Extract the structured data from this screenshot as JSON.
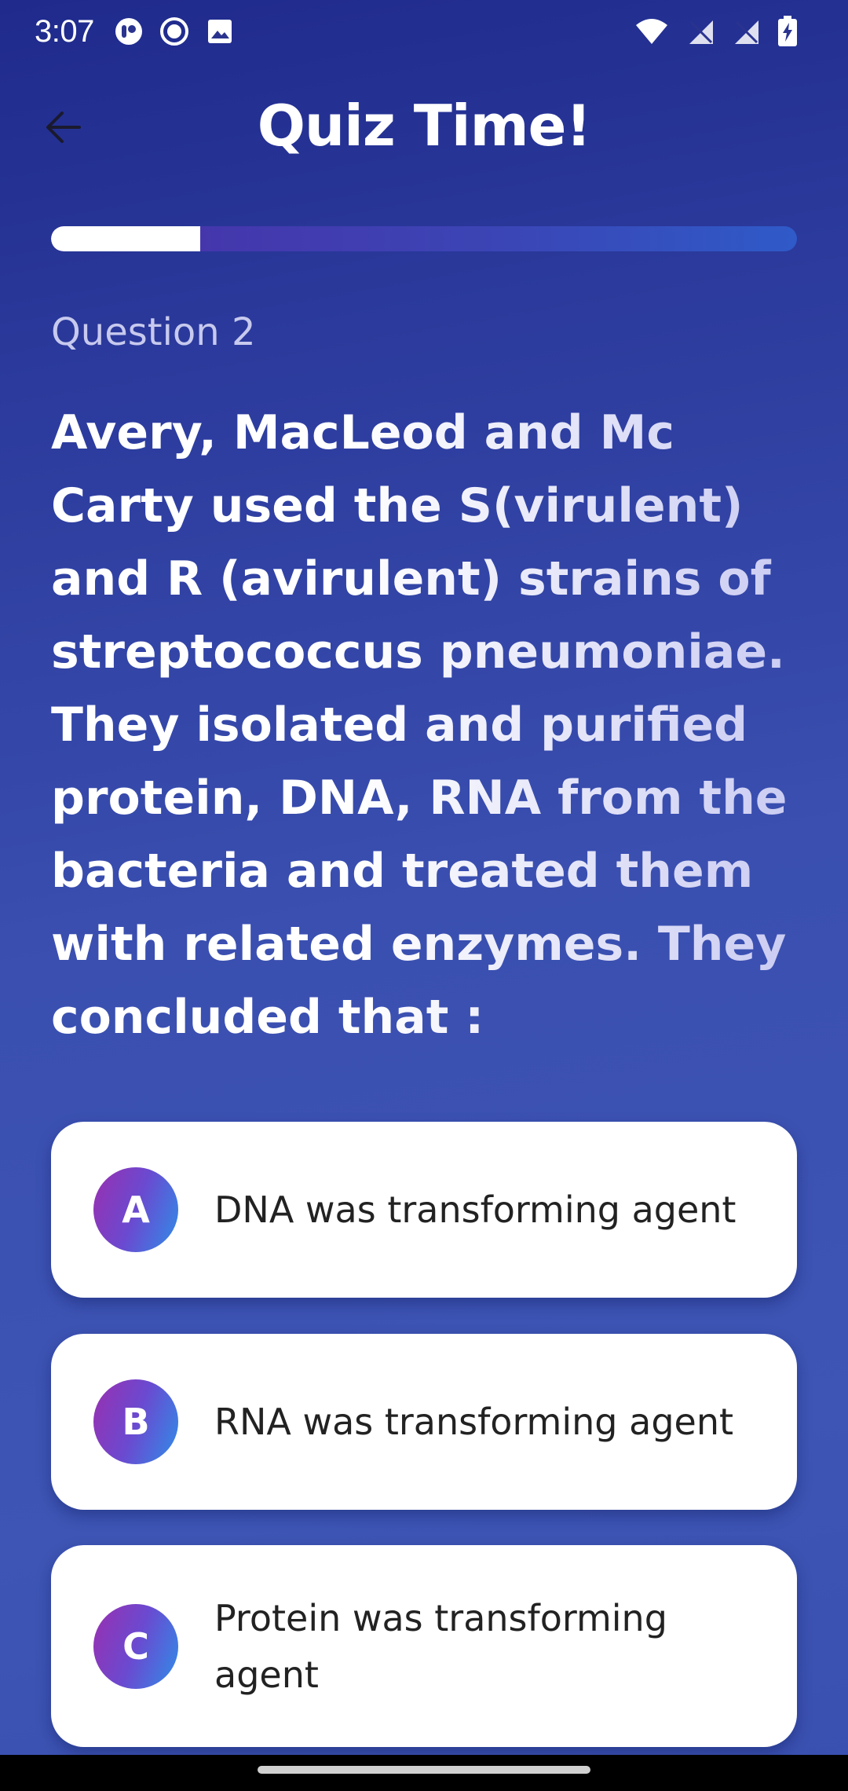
{
  "status_bar": {
    "time": "3:07",
    "left_icons": [
      "app-notification-icon",
      "circle-record-icon",
      "image-icon"
    ],
    "right_icons": [
      "wifi-icon",
      "signal-off-icon",
      "signal-off-icon",
      "battery-charging-icon"
    ]
  },
  "header": {
    "title": "Quiz Time!",
    "back_icon": "arrow-left-icon"
  },
  "progress": {
    "fraction": 0.2
  },
  "question": {
    "label": "Question 2",
    "text": "Avery, MacLeod and Mc Carty used the S(virulent) and R (avirulent) strains of streptococcus pneumoniae. They isolated and purified protein, DNA, RNA from the bacteria and treated them with related enzymes. They concluded that :"
  },
  "options": [
    {
      "letter": "A",
      "text": "DNA was transforming agent"
    },
    {
      "letter": "B",
      "text": "RNA was transforming agent"
    },
    {
      "letter": "C",
      "text": "Protein was transforming agent"
    }
  ],
  "colors": {
    "background_top": "#1f2a8c",
    "background_bottom": "#3e55b5",
    "progress_fill": "#ffffff",
    "option_badge_start": "#9a2fb0",
    "option_badge_end": "#2f8de8"
  }
}
